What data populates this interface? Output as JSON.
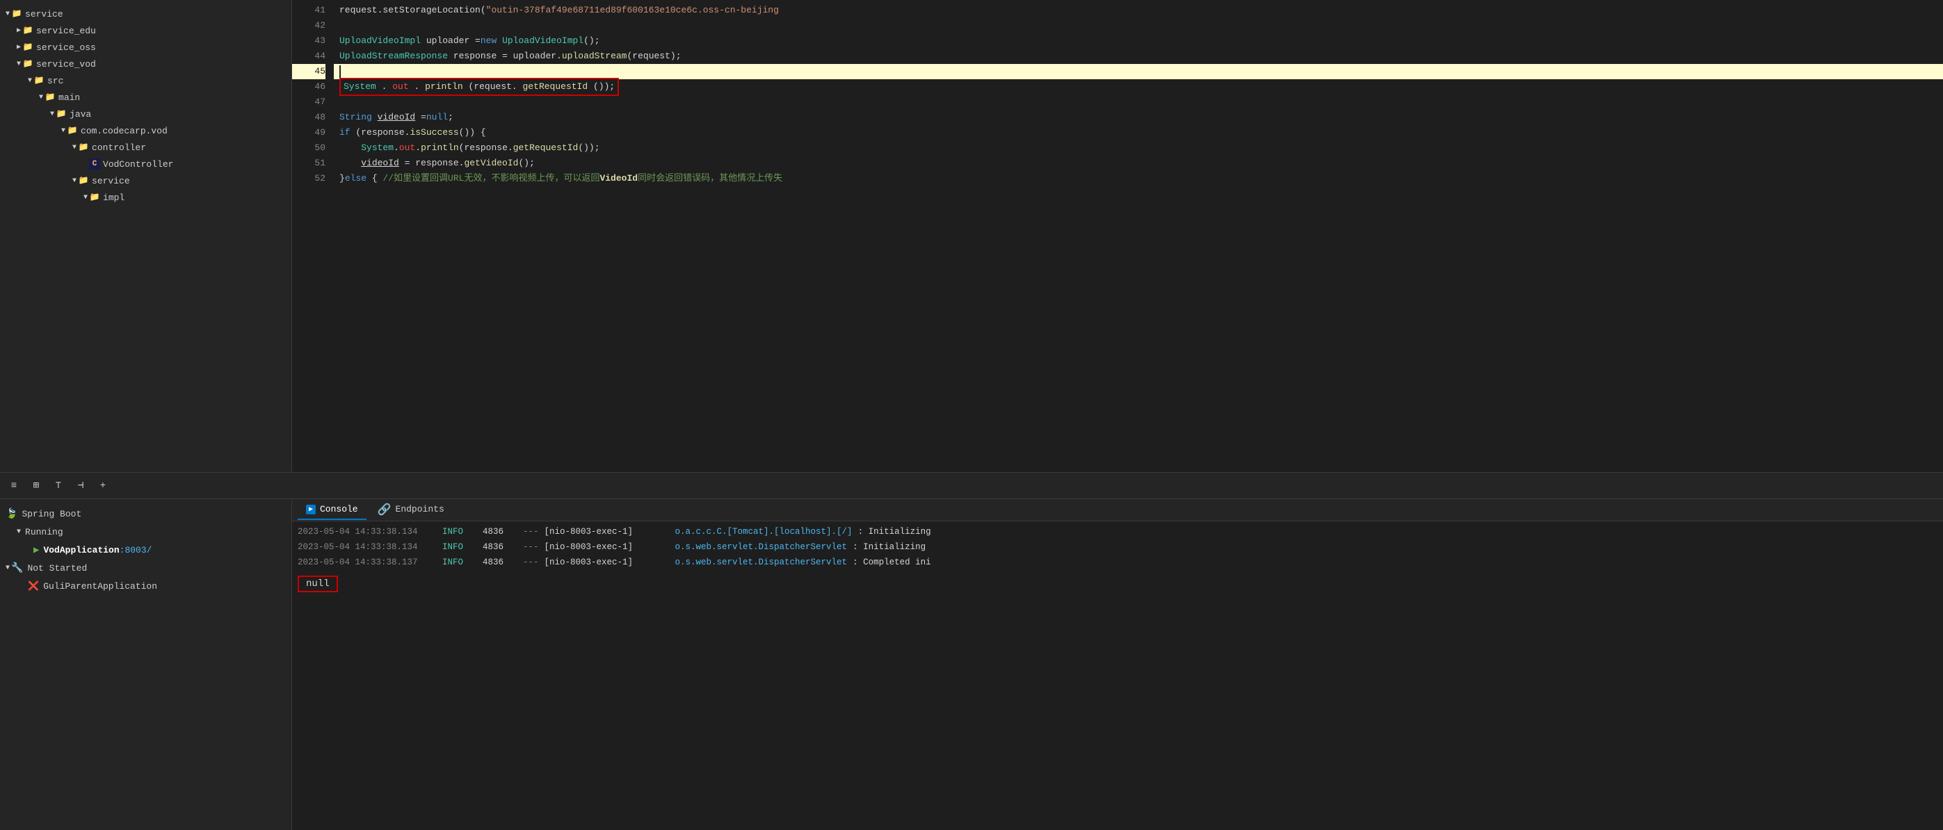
{
  "sidebar": {
    "title": "service",
    "items": [
      {
        "id": "service-root",
        "label": "service",
        "indent": "indent-0",
        "type": "root",
        "chevron": "▼",
        "icon": "📁"
      },
      {
        "id": "service-edu",
        "label": "service_edu",
        "indent": "indent-1",
        "type": "folder",
        "chevron": "▶",
        "icon": "📁"
      },
      {
        "id": "service-oss",
        "label": "service_oss",
        "indent": "indent-1",
        "type": "folder",
        "chevron": "▶",
        "icon": "📁"
      },
      {
        "id": "service-vod",
        "label": "service_vod",
        "indent": "indent-1",
        "type": "folder",
        "chevron": "▼",
        "icon": "📁"
      },
      {
        "id": "src",
        "label": "src",
        "indent": "indent-2",
        "type": "folder",
        "chevron": "▼",
        "icon": "📁"
      },
      {
        "id": "main",
        "label": "main",
        "indent": "indent-3",
        "type": "folder",
        "chevron": "▼",
        "icon": "📁"
      },
      {
        "id": "java",
        "label": "java",
        "indent": "indent-4",
        "type": "folder",
        "chevron": "▼",
        "icon": "📁"
      },
      {
        "id": "com-codecarp-vod",
        "label": "com.codecarp.vod",
        "indent": "indent-5",
        "type": "folder",
        "chevron": "▼",
        "icon": "📁"
      },
      {
        "id": "controller",
        "label": "controller",
        "indent": "indent-6",
        "type": "folder",
        "chevron": "▼",
        "icon": "📁"
      },
      {
        "id": "VodController",
        "label": "VodController",
        "indent": "indent-7",
        "type": "class",
        "chevron": "",
        "icon": "C"
      },
      {
        "id": "service-pkg",
        "label": "service",
        "indent": "indent-6",
        "type": "folder",
        "chevron": "▼",
        "icon": "📁"
      },
      {
        "id": "impl-pkg",
        "label": "impl",
        "indent": "indent-7",
        "type": "folder",
        "chevron": "▼",
        "icon": "📁"
      }
    ]
  },
  "editor": {
    "lines": [
      {
        "num": 41,
        "content": "request.setStorageLocation(\"outin-378faf49e68711ed89f600163e10ce6c.oss-cn-beijing",
        "highlight": false
      },
      {
        "num": 42,
        "content": "",
        "highlight": false
      },
      {
        "num": 43,
        "content": "UploadVideoImpl uploader = new UploadVideoImpl();",
        "highlight": false
      },
      {
        "num": 44,
        "content": "UploadStreamResponse response = uploader.uploadStream(request);",
        "highlight": false
      },
      {
        "num": 45,
        "content": "",
        "highlight": true,
        "cursor": true
      },
      {
        "num": 46,
        "content": "System.out.println(request.getRequestId());",
        "highlight": false,
        "boxed": true
      },
      {
        "num": 47,
        "content": "",
        "highlight": false
      },
      {
        "num": 48,
        "content": "String videoId = null;",
        "highlight": false
      },
      {
        "num": 49,
        "content": "if (response.isSuccess()) {",
        "highlight": false
      },
      {
        "num": 50,
        "content": "    System.out.println(response.getRequestId());",
        "highlight": false
      },
      {
        "num": 51,
        "content": "    videoId = response.getVideoId();",
        "highlight": false
      },
      {
        "num": 52,
        "content": "} else { //如里设置回调URL无效，不影响视频上传，可以返回VideoId同时会返回错误码，其他情况上传失",
        "highlight": false
      }
    ]
  },
  "bottom": {
    "toolbar": {
      "buttons": [
        "≡",
        "⊞",
        "⊤",
        "⊣",
        "+"
      ]
    },
    "run_panel": {
      "spring_boot_label": "Spring Boot",
      "running_label": "Running",
      "vod_app_label": "VodApplication",
      "vod_port": ":8003/",
      "not_started_label": "Not Started",
      "guli_parent_label": "GuliParentApplication"
    },
    "console": {
      "tabs": [
        {
          "label": "Console",
          "active": true
        },
        {
          "label": "Endpoints",
          "active": false
        }
      ],
      "logs": [
        {
          "timestamp": "2023-05-04 14:33:38.134",
          "level": "INFO",
          "pid": "4836",
          "thread": "[nio-8003-exec-1]",
          "class": "o.a.c.c.C.[Tomcat].[localhost].[/]",
          "message": ": Initializing"
        },
        {
          "timestamp": "2023-05-04 14:33:38.134",
          "level": "INFO",
          "pid": "4836",
          "thread": "[nio-8003-exec-1]",
          "class": "o.s.web.servlet.DispatcherServlet",
          "message": ": Initializing"
        },
        {
          "timestamp": "2023-05-04 14:33:38.137",
          "level": "INFO",
          "pid": "4836",
          "thread": "[nio-8003-exec-1]",
          "class": "o.s.web.servlet.DispatcherServlet",
          "message": ": Completed ini"
        }
      ],
      "null_output": "null"
    }
  }
}
